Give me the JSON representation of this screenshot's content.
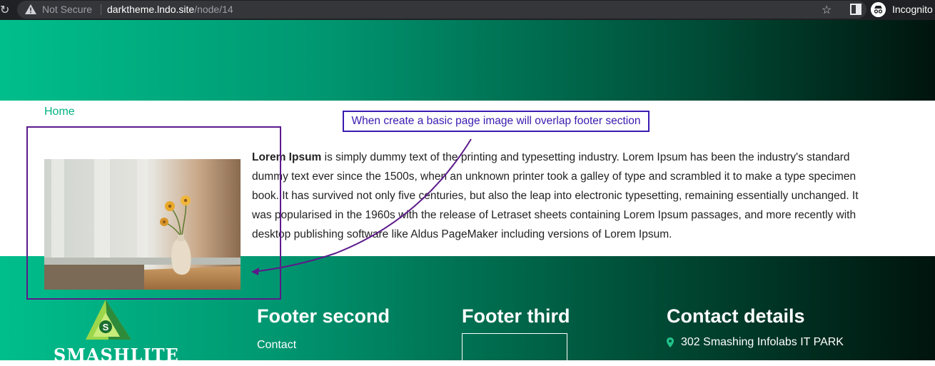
{
  "browser": {
    "security_label": "Not Secure",
    "url_host": "darktheme.lndo.site",
    "url_path": "/node/14",
    "profile_label": "Incognito"
  },
  "breadcrumb": {
    "home_label": "Home"
  },
  "article": {
    "lead": "Lorem Ipsum",
    "body": " is simply dummy text of the printing and typesetting industry. Lorem Ipsum has been the industry's standard dummy text ever since the 1500s, when an unknown printer took a galley of type and scrambled it to make a type specimen book. It has survived not only five centuries, but also the leap into electronic typesetting, remaining essentially unchanged. It was popularised in the 1960s with the release of Letraset sheets containing Lorem Ipsum passages, and more recently with desktop publishing software like Aldus PageMaker including versions of Lorem Ipsum."
  },
  "annotation": {
    "note": "When create a basic page image will overlap footer section"
  },
  "footer": {
    "logo_text": "SMASHLITE",
    "second_title": "Footer second",
    "second_link": "Contact",
    "third_title": "Footer third",
    "contact_title": "Contact details",
    "address": "302 Smashing Infolabs IT PARK"
  },
  "colors": {
    "accent": "#00b383",
    "annotation_border": "#5c1a8a",
    "note_text": "#3a1bb0"
  },
  "icons": [
    "reload-icon",
    "warning-icon",
    "star-icon",
    "side-panel-icon",
    "incognito-icon",
    "location-pin-icon",
    "arrow-icon"
  ]
}
